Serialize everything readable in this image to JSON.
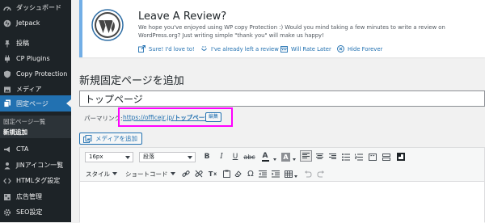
{
  "sidebar": {
    "items": [
      {
        "label": "ダッシュボード",
        "icon": "dashboard-icon"
      },
      {
        "label": "Jetpack",
        "icon": "jetpack-icon"
      },
      {
        "label": "投稿",
        "icon": "pin-icon"
      },
      {
        "label": "CP Plugins",
        "icon": "plugin-icon"
      },
      {
        "label": "Copy Protection",
        "icon": "shield-icon"
      },
      {
        "label": "メディア",
        "icon": "media-icon"
      },
      {
        "label": "固定ページ",
        "icon": "pages-icon"
      },
      {
        "label": "CTA",
        "icon": "megaphone-icon"
      },
      {
        "label": "JINアイコン一覧",
        "icon": "person-icon"
      },
      {
        "label": "HTMLタグ設定",
        "icon": "html-icon"
      },
      {
        "label": "広告管理",
        "icon": "ads-icon"
      },
      {
        "label": "SEO設定",
        "icon": "gear-icon"
      }
    ],
    "submenu": [
      "固定ページ一覧",
      "新規追加"
    ]
  },
  "notice": {
    "title": "Leave A Review?",
    "text": "We hope you've enjoyed using WP copy Protection :) Would you mind taking a few minutes to write a review on WordPress.org? Just writing simple \"thank you\" will make us happy!",
    "links": [
      "Sure! I'd love to!",
      "I've already left a review",
      "Will Rate Later",
      "Hide Forever"
    ]
  },
  "editor": {
    "heading": "新規固定ページを追加",
    "title_value": "トップページ",
    "permalink_label": "パーマリンク:",
    "permalink_base": "https://officejr.jp/",
    "permalink_slug": "トップページ",
    "edit_label": "編集",
    "add_media_label": "メディアを追加",
    "font_size": "16px",
    "format": "段落",
    "style_label": "スタイル",
    "shortcode_label": "ショートコード"
  }
}
